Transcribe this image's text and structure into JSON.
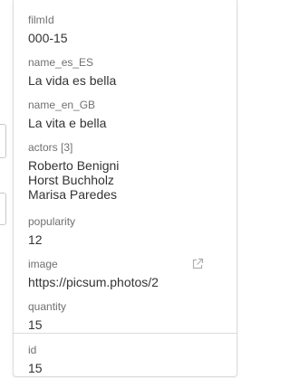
{
  "record": {
    "fields": [
      {
        "label": "filmId",
        "value": "000-15"
      },
      {
        "label": "name_es_ES",
        "value": "La vida es bella"
      },
      {
        "label": "name_en_GB",
        "value": "La vita e bella"
      },
      {
        "label": "actors [3]",
        "values": [
          "Roberto Benigni",
          "Horst Buchholz",
          "Marisa Paredes"
        ]
      },
      {
        "label": "popularity",
        "value": "12"
      },
      {
        "label": "image",
        "value": "https://picsum.photos/2",
        "icon": "external-link-icon"
      },
      {
        "label": "quantity",
        "value": "15"
      }
    ],
    "footer_field": {
      "label": "id",
      "value": "15"
    }
  },
  "colors": {
    "label": "#707070",
    "value": "#333333",
    "border": "#dcdcdc",
    "icon": "#b0b0b0"
  }
}
